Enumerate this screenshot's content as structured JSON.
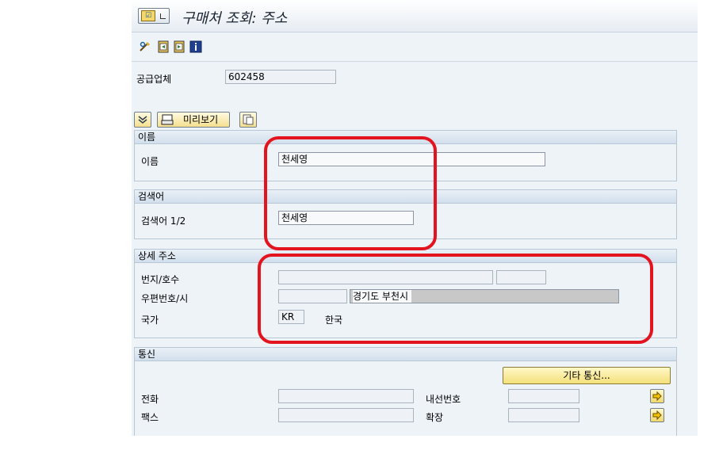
{
  "window": {
    "title": "구매처 조회: 주소"
  },
  "vendor": {
    "label": "공급업체",
    "value": "602458"
  },
  "actions": {
    "preview_label": "미리보기"
  },
  "sections": {
    "name": {
      "title": "이름",
      "field_label": "이름",
      "value": "천세영"
    },
    "search": {
      "title": "검색어",
      "field_label": "검색어 1/2",
      "value": "천세영"
    },
    "address": {
      "title": "상세 주소",
      "street_label": "번지/호수",
      "street_value": "",
      "house_value": "",
      "postal_label": "우편번호/시",
      "postal_value": "",
      "city_value": "경기도 부천시",
      "country_label": "국가",
      "country_code": "KR",
      "country_name": "한국"
    },
    "comm": {
      "title": "통신",
      "other_button": "기타 통신...",
      "phone_label": "전화",
      "phone_value": "",
      "ext_label": "내선번호",
      "ext_value": "",
      "fax_label": "팩스",
      "fax_value": "",
      "fax_ext_label": "확장",
      "fax_ext_value": ""
    }
  },
  "colors": {
    "annotation": "#e3141e",
    "button": "#f4e07a"
  }
}
